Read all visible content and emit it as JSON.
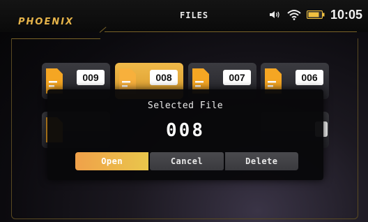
{
  "header": {
    "logo": "PHOENIX",
    "title": "FILES",
    "time": "10:05"
  },
  "status_icons": [
    "speaker-icon",
    "wifi-icon",
    "battery-icon"
  ],
  "files": [
    {
      "label": "009",
      "selected": false
    },
    {
      "label": "008",
      "selected": true
    },
    {
      "label": "007",
      "selected": false
    },
    {
      "label": "006",
      "selected": false
    }
  ],
  "dialog": {
    "title": "Selected File",
    "value": "008",
    "buttons": {
      "open": "Open",
      "cancel": "Cancel",
      "delete": "Delete"
    }
  },
  "colors": {
    "accent": "#e6b44a",
    "selected_tile": "#f0b94a",
    "doc_icon": "#f5a623"
  }
}
